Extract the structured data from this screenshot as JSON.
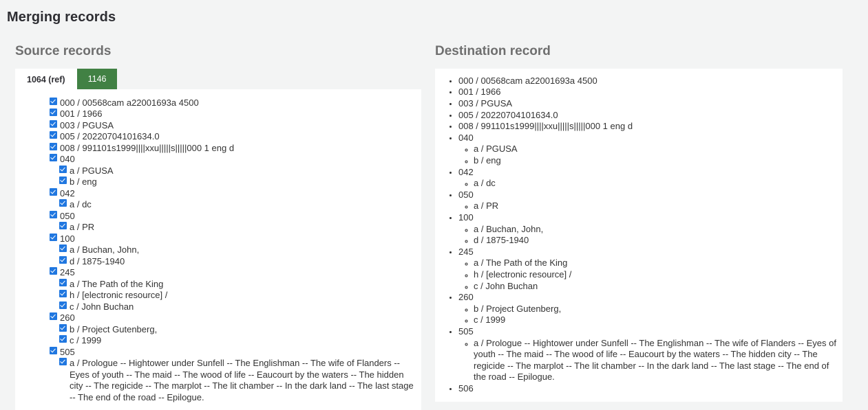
{
  "page": {
    "title": "Merging records"
  },
  "source": {
    "heading": "Source records",
    "tabs": [
      {
        "label": "1064 (ref)",
        "active": true
      },
      {
        "label": "1146",
        "active": false
      }
    ],
    "fields": [
      {
        "tag": "000",
        "value": "/ 00568cam a22001693a 4500",
        "checked": true,
        "subfields": []
      },
      {
        "tag": "001",
        "value": "/ 1966",
        "checked": true,
        "subfields": []
      },
      {
        "tag": "003",
        "value": "/ PGUSA",
        "checked": true,
        "subfields": []
      },
      {
        "tag": "005",
        "value": "/ 20220704101634.0",
        "checked": true,
        "subfields": []
      },
      {
        "tag": "008",
        "value": "/ 991101s1999||||xxu|||||s|||||000 1 eng d",
        "checked": true,
        "subfields": []
      },
      {
        "tag": "040",
        "value": "",
        "checked": true,
        "subfields": [
          {
            "label": "a / PGUSA",
            "checked": true
          },
          {
            "label": "b / eng",
            "checked": true
          }
        ]
      },
      {
        "tag": "042",
        "value": "",
        "checked": true,
        "subfields": [
          {
            "label": "a / dc",
            "checked": true
          }
        ]
      },
      {
        "tag": "050",
        "value": "",
        "checked": true,
        "subfields": [
          {
            "label": "a / PR",
            "checked": true
          }
        ]
      },
      {
        "tag": "100",
        "value": "",
        "checked": true,
        "subfields": [
          {
            "label": "a / Buchan, John,",
            "checked": true
          },
          {
            "label": "d / 1875-1940",
            "checked": true
          }
        ]
      },
      {
        "tag": "245",
        "value": "",
        "checked": true,
        "subfields": [
          {
            "label": "a / The Path of the King",
            "checked": true
          },
          {
            "label": "h / [electronic resource] /",
            "checked": true
          },
          {
            "label": "c / John Buchan",
            "checked": true
          }
        ]
      },
      {
        "tag": "260",
        "value": "",
        "checked": true,
        "subfields": [
          {
            "label": "b / Project Gutenberg,",
            "checked": true
          },
          {
            "label": "c / 1999",
            "checked": true
          }
        ]
      },
      {
        "tag": "505",
        "value": "",
        "checked": true,
        "subfields": [
          {
            "label": "a / Prologue -- Hightower under Sunfell -- The Englishman -- The wife of Flanders -- Eyes of youth -- The maid -- The wood of life -- Eaucourt by the waters -- The hidden city -- The regicide -- The marplot -- The lit chamber -- In the dark land -- The last stage -- The end of the road -- Epilogue.",
            "checked": true
          }
        ]
      }
    ]
  },
  "destination": {
    "heading": "Destination record",
    "fields": [
      {
        "tag": "000",
        "value": "/ 00568cam a22001693a 4500",
        "subfields": []
      },
      {
        "tag": "001",
        "value": "/ 1966",
        "subfields": []
      },
      {
        "tag": "003",
        "value": "/ PGUSA",
        "subfields": []
      },
      {
        "tag": "005",
        "value": "/ 20220704101634.0",
        "subfields": []
      },
      {
        "tag": "008",
        "value": "/ 991101s1999||||xxu|||||s|||||000 1 eng d",
        "subfields": []
      },
      {
        "tag": "040",
        "value": "",
        "subfields": [
          "a / PGUSA",
          "b / eng"
        ]
      },
      {
        "tag": "042",
        "value": "",
        "subfields": [
          "a / dc"
        ]
      },
      {
        "tag": "050",
        "value": "",
        "subfields": [
          "a / PR"
        ]
      },
      {
        "tag": "100",
        "value": "",
        "subfields": [
          "a / Buchan, John,",
          "d / 1875-1940"
        ]
      },
      {
        "tag": "245",
        "value": "",
        "subfields": [
          "a / The Path of the King",
          "h / [electronic resource] /",
          "c / John Buchan"
        ]
      },
      {
        "tag": "260",
        "value": "",
        "subfields": [
          "b / Project Gutenberg,",
          "c / 1999"
        ]
      },
      {
        "tag": "505",
        "value": "",
        "subfields": [
          "a / Prologue -- Hightower under Sunfell -- The Englishman -- The wife of Flanders -- Eyes of youth -- The maid -- The wood of life -- Eaucourt by the waters -- The hidden city -- The regicide -- The marplot -- The lit chamber -- In the dark land -- The last stage -- The end of the road -- Epilogue."
        ]
      },
      {
        "tag": "506",
        "value": "",
        "subfields": []
      }
    ]
  },
  "colors": {
    "page_background": "#f3f4f4",
    "panel_background": "#ffffff",
    "checkbox_blue": "#2077e0",
    "tab_green": "#418144",
    "heading_gray": "#6f6f6f",
    "text": "#333333"
  }
}
